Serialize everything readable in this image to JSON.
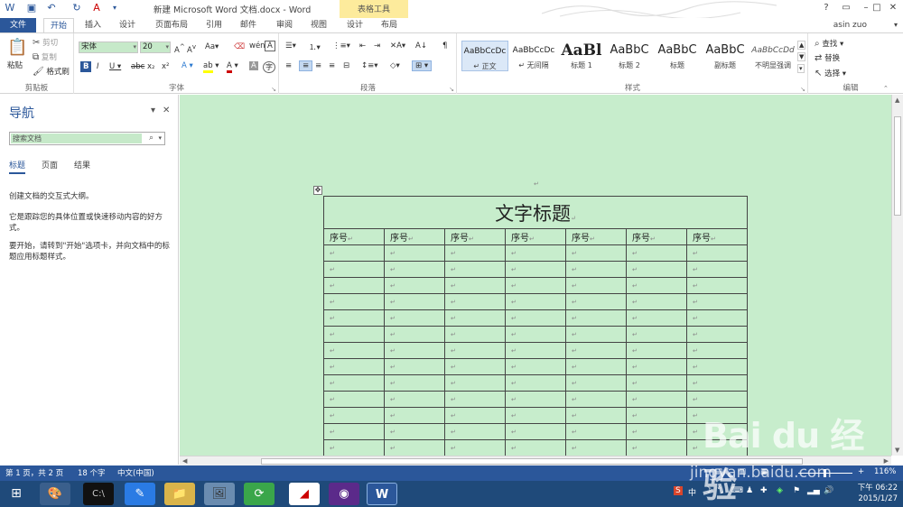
{
  "titlebar": {
    "title": "新建 Microsoft Word 文档.docx - Word",
    "context_group": "表格工具",
    "help": "?",
    "minimize": "–",
    "restore": "□",
    "close": "✕"
  },
  "tabs": [
    {
      "label": "文件"
    },
    {
      "label": "开始"
    },
    {
      "label": "插入"
    },
    {
      "label": "设计"
    },
    {
      "label": "页面布局"
    },
    {
      "label": "引用"
    },
    {
      "label": "邮件"
    },
    {
      "label": "审阅"
    },
    {
      "label": "视图"
    },
    {
      "label": "设计"
    },
    {
      "label": "布局"
    }
  ],
  "user": "asin zuo",
  "ribbon": {
    "clipboard": {
      "label": "剪贴板",
      "paste": "粘贴",
      "cut": "剪切",
      "copy": "复制",
      "format_painter": "格式刷"
    },
    "font": {
      "label": "字体",
      "font_name": "宋体",
      "font_size": "20"
    },
    "paragraph": {
      "label": "段落"
    },
    "styles": {
      "label": "样式",
      "items": [
        {
          "preview": "AaBbCcDc",
          "name": "↵ 正文"
        },
        {
          "preview": "AaBbCcDc",
          "name": "↵ 无间隔"
        },
        {
          "preview": "AaBl",
          "name": "标题 1"
        },
        {
          "preview": "AaBbC",
          "name": "标题 2"
        },
        {
          "preview": "AaBbC",
          "name": "标题"
        },
        {
          "preview": "AaBbC",
          "name": "副标题"
        },
        {
          "preview": "AaBbCcDd",
          "name": "不明显强调"
        }
      ]
    },
    "editing": {
      "label": "编辑",
      "find": "查找",
      "replace": "替换",
      "select": "选择"
    }
  },
  "nav": {
    "title": "导航",
    "search_placeholder": "搜索文档",
    "tabs": [
      "标题",
      "页面",
      "结果"
    ],
    "text1": "创建文档的交互式大纲。",
    "text2": "它是跟踪您的具体位置或快速移动内容的好方式。",
    "text3": "要开始，请转到\"开始\"选项卡，并向文档中的标题应用标题样式。"
  },
  "document": {
    "table_title": "文字标题",
    "header_cell": "序号",
    "columns": 7,
    "empty_rows": 13,
    "para_mark": "↵"
  },
  "status": {
    "page": "第 1 页，共 2 页",
    "words": "18 个字",
    "language": "中文(中国)",
    "zoom": "116%"
  },
  "taskbar": {
    "time": "下午 06:22",
    "date": "2015/1/27",
    "ime": "中"
  },
  "watermark": {
    "text": "Bai du 经验",
    "url": "jingyan.baidu.com"
  },
  "colors": {
    "accent": "#2b579a",
    "document_bg": "#c7edcc",
    "context_tab": "#fdeb9c"
  }
}
